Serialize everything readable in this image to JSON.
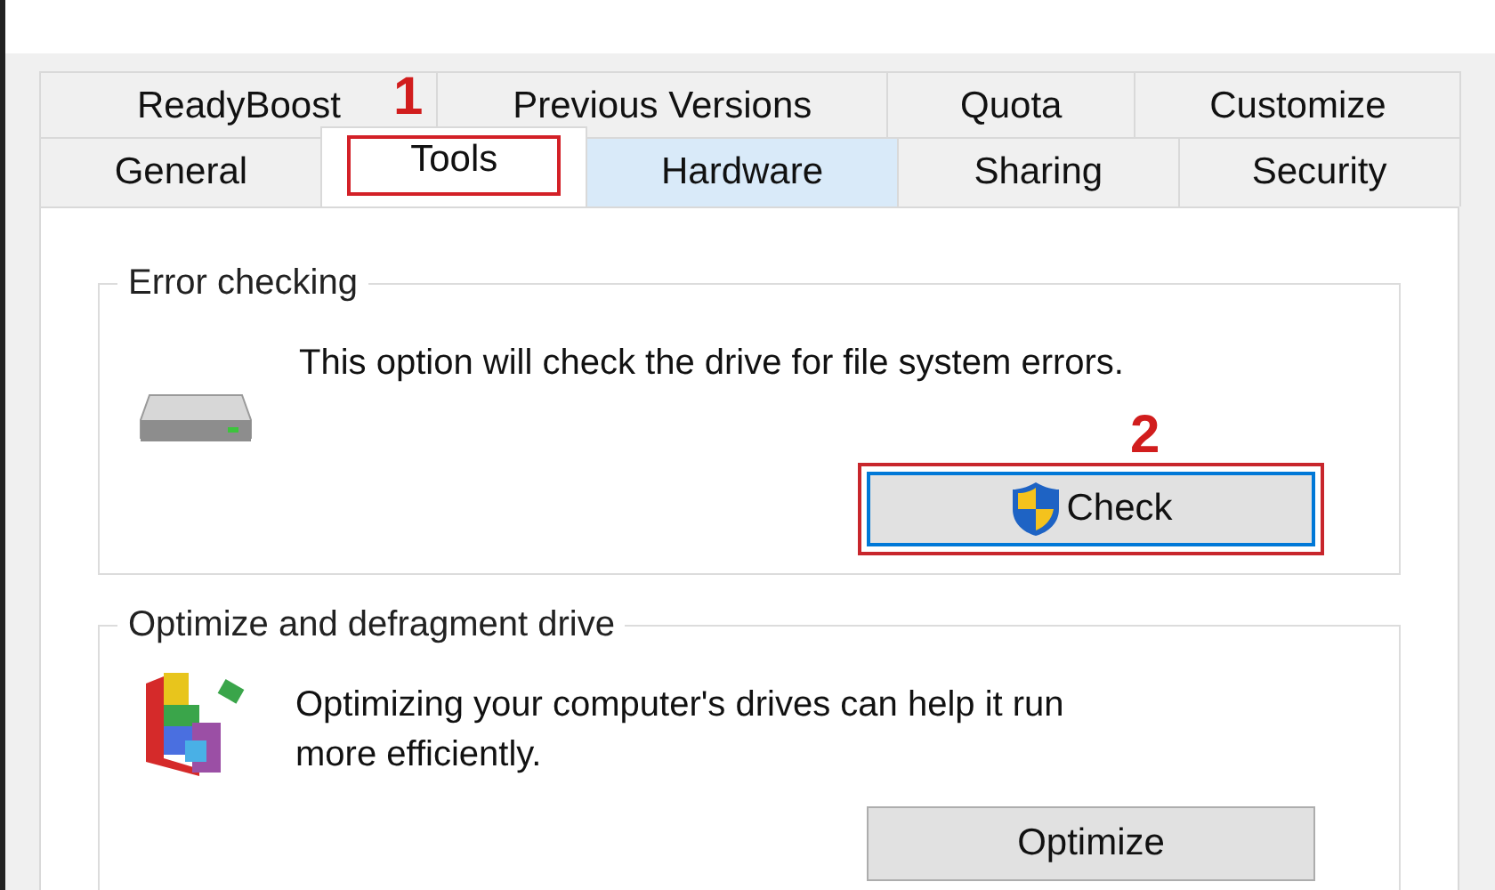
{
  "tab_rows": [
    {
      "tabs": [
        {
          "label": "ReadyBoost",
          "selected": false,
          "hovered": false,
          "marked": false
        },
        {
          "label": "Previous Versions",
          "selected": false,
          "hovered": false,
          "marked": false
        },
        {
          "label": "Quota",
          "selected": false,
          "hovered": false,
          "marked": false
        },
        {
          "label": "Customize",
          "selected": false,
          "hovered": false,
          "marked": false
        }
      ]
    },
    {
      "tabs": [
        {
          "label": "General",
          "selected": false,
          "hovered": false,
          "marked": false
        },
        {
          "label": "Tools",
          "selected": true,
          "hovered": false,
          "marked": true
        },
        {
          "label": "Hardware",
          "selected": false,
          "hovered": true,
          "marked": false
        },
        {
          "label": "Sharing",
          "selected": false,
          "hovered": false,
          "marked": false
        },
        {
          "label": "Security",
          "selected": false,
          "hovered": false,
          "marked": false
        }
      ]
    }
  ],
  "annotations": [
    {
      "number": "1"
    },
    {
      "number": "2"
    }
  ],
  "groups": [
    {
      "kind": "drive",
      "title": "Error checking",
      "description": "This option will check the drive for file system errors.",
      "button": {
        "label": "Check",
        "shield": true,
        "focused": true,
        "marked": true
      }
    },
    {
      "kind": "defrag",
      "title": "Optimize and defragment drive",
      "description": "Optimizing your computer's drives can help it run more efficiently.",
      "button": {
        "label": "Optimize",
        "shield": false,
        "focused": false,
        "marked": false
      }
    }
  ]
}
